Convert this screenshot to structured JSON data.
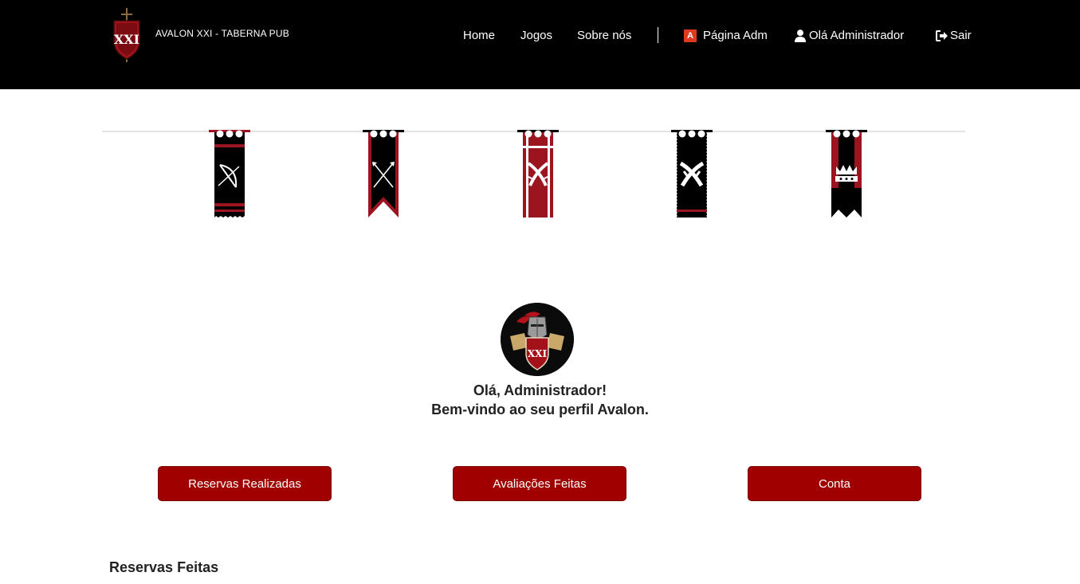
{
  "header": {
    "brand": "AVALON XXI - TABERNA PUB",
    "nav": {
      "home": "Home",
      "jogos": "Jogos",
      "sobre": "Sobre nós",
      "admin": "Página Adm",
      "admin_icon_letter": "A",
      "user": "Olá Administrador",
      "logout": "Sair"
    },
    "icons": {
      "logo": "avalon-shield-logo",
      "admin": "angular-a-icon",
      "user": "user-icon",
      "logout": "sign-out-icon"
    }
  },
  "banners": [
    {
      "name": "bow-arrow-banner",
      "color": "#000000",
      "accent": "#9b1420"
    },
    {
      "name": "crossed-arrows-banner",
      "color": "#000000",
      "accent": "#9b1420"
    },
    {
      "name": "crossed-swords-banner",
      "color": "#9b1420",
      "accent": "#000000"
    },
    {
      "name": "crossed-swords-dark-banner",
      "color": "#000000",
      "accent": "#9b1420"
    },
    {
      "name": "crown-banner",
      "color": "#000000",
      "accent": "#9b1420"
    }
  ],
  "profile": {
    "greeting": "Olá, Administrador!",
    "welcome": "Bem-vindo ao seu perfil Avalon."
  },
  "actions": {
    "reservas": "Reservas Realizadas",
    "avaliacoes": "Avaliações Feitas",
    "conta": "Conta"
  },
  "sections": {
    "reservas_feitas": "Reservas Feitas"
  },
  "colors": {
    "header_bg": "#000000",
    "button_bg": "#a00000",
    "banner_red": "#9b1420"
  }
}
